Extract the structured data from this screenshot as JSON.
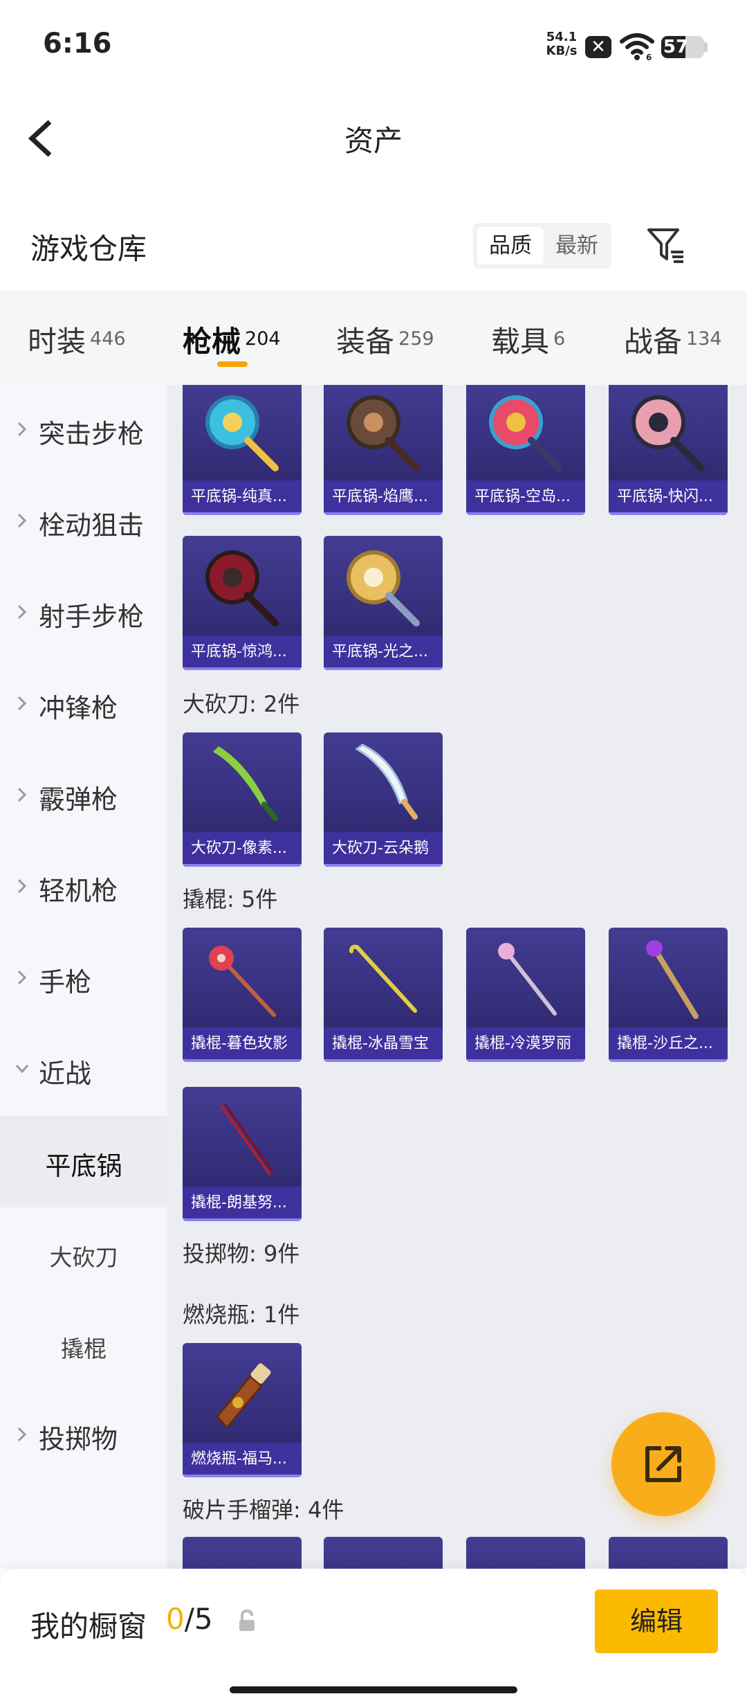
{
  "status_bar": {
    "time": "6:16",
    "net_speed_value": "54.1",
    "net_speed_unit": "KB/s",
    "battery_level": "57",
    "battery_fraction": 0.57
  },
  "header": {
    "title": "资产"
  },
  "warehouse": {
    "title": "游戏仓库",
    "sort_quality": "品质",
    "sort_newest": "最新"
  },
  "tabs": [
    {
      "label": "时装",
      "count": "446"
    },
    {
      "label": "枪械",
      "count": "204"
    },
    {
      "label": "装备",
      "count": "259"
    },
    {
      "label": "载具",
      "count": "6"
    },
    {
      "label": "战备",
      "count": "134"
    }
  ],
  "sidebar": {
    "categories": [
      "突击步枪",
      "栓动狙击",
      "射手步枪",
      "冲锋枪",
      "霰弹枪",
      "轻机枪",
      "手枪",
      "近战"
    ],
    "sub_items": [
      "平底锅",
      "大砍刀",
      "撬棍"
    ],
    "last_category": "投掷物"
  },
  "sections": {
    "pan_items": [
      "平底锅-纯真...",
      "平底锅-焰鹰...",
      "平底锅-空岛...",
      "平底锅-快闪...",
      "平底锅-惊鸿...",
      "平底锅-光之..."
    ],
    "machete_title": "大砍刀: 2件",
    "machete_items": [
      "大砍刀-像素...",
      "大砍刀-云朵鹅"
    ],
    "crowbar_title": "撬棍: 5件",
    "crowbar_items": [
      "撬棍-暮色玫影",
      "撬棍-冰晶雪宝",
      "撬棍-冷漠罗丽",
      "撬棍-沙丘之...",
      "撬棍-朗基努..."
    ],
    "throwable_title": "投掷物: 9件",
    "molotov_title": "燃烧瓶: 1件",
    "molotov_items": [
      "燃烧瓶-福马..."
    ],
    "frag_title": "破片手榴弹: 4件"
  },
  "bottom_bar": {
    "showcase_label": "我的橱窗",
    "showcase_current": "0",
    "showcase_total": "/5",
    "edit_label": "编辑"
  },
  "colors": {
    "accent": "#f7a400",
    "fab": "#f9ad1b",
    "edit_button": "#fbb900",
    "card_bg": "#3b3486",
    "card_label": "#4032a0"
  },
  "icons": [
    "back-arrow-icon",
    "filter-icon",
    "chevron-right-icon",
    "chevron-down-icon",
    "share-icon",
    "lock-icon",
    "wifi-icon"
  ]
}
